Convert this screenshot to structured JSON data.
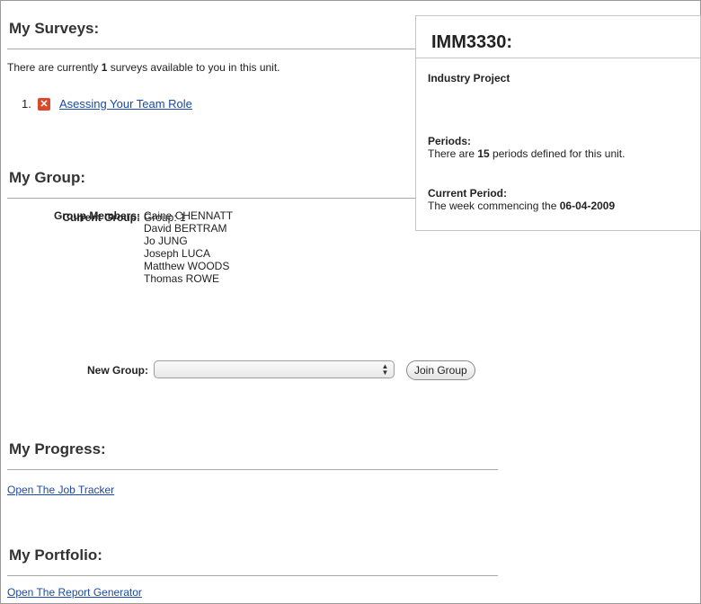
{
  "surveys": {
    "title": "My Surveys:",
    "intro_before": "There are currently ",
    "count": "1",
    "intro_after": " surveys available to you in this unit.",
    "items": [
      {
        "number": "1.",
        "label": "Asessing Your Team Role",
        "status_icon": "close-icon"
      }
    ]
  },
  "group": {
    "title": "My Group:",
    "current_label": "Current Group:",
    "current_value": "Group: 1",
    "members_label": "Group Members:",
    "members": [
      "Caine CHENNATT",
      "David BERTRAM",
      "Jo JUNG",
      "Joseph LUCA",
      "Matthew WOODS",
      "Thomas ROWE"
    ],
    "new_group_label": "New Group:",
    "new_group_selected": "",
    "join_button": "Join Group"
  },
  "progress": {
    "title": "My Progress:",
    "link": "Open The Job Tracker"
  },
  "portfolio": {
    "title": "My Portfolio:",
    "link": "Open The Report Generator"
  },
  "unit": {
    "code": "IMM3330:",
    "name": "Industry Project",
    "periods_heading": "Periods:",
    "periods_before": "There are ",
    "periods_count": "15",
    "periods_after": " periods defined for this unit.",
    "current_heading": "Current Period:",
    "current_before": "The week commencing the ",
    "current_date": "06-04-2009"
  },
  "colors": {
    "link": "#1a4aa5",
    "survey_icon": "#d94a2d"
  }
}
